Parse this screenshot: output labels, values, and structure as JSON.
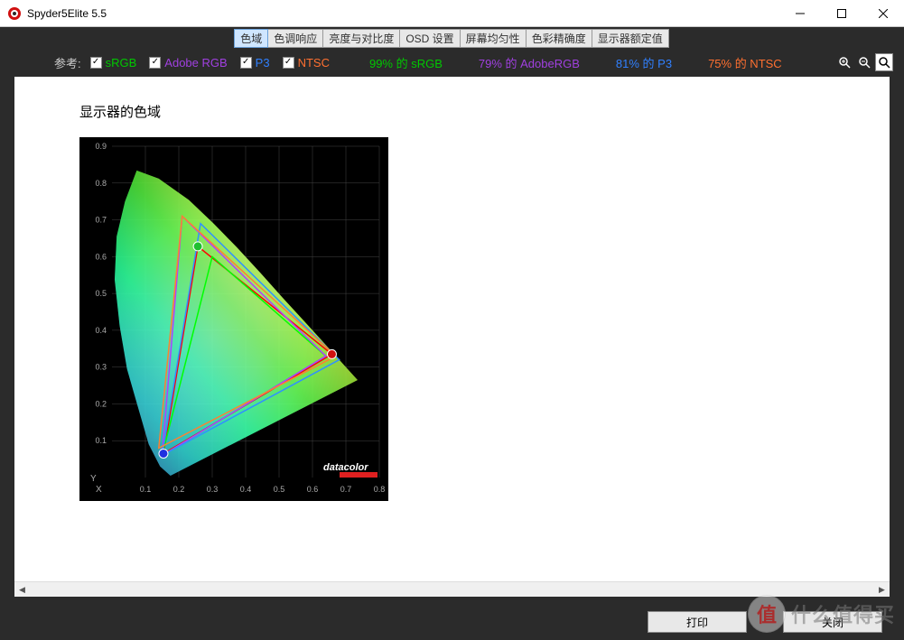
{
  "title": "Spyder5Elite 5.5",
  "tabs": [
    {
      "label": "色域",
      "active": true
    },
    {
      "label": "色调响应",
      "active": false
    },
    {
      "label": "亮度与对比度",
      "active": false
    },
    {
      "label": "OSD 设置",
      "active": false
    },
    {
      "label": "屏幕均匀性",
      "active": false
    },
    {
      "label": "色彩精确度",
      "active": false
    },
    {
      "label": "显示器额定值",
      "active": false
    }
  ],
  "reference_label": "参考:",
  "checkboxes": {
    "srgb": {
      "label": "sRGB",
      "checked": true
    },
    "adobergb": {
      "label": "Adobe RGB",
      "checked": true
    },
    "p3": {
      "label": "P3",
      "checked": true
    },
    "ntsc": {
      "label": "NTSC",
      "checked": true
    }
  },
  "coverage": {
    "srgb": "99% 的 sRGB",
    "adobergb": "79% 的 AdobeRGB",
    "p3": "81% 的 P3",
    "ntsc": "75% 的 NTSC"
  },
  "chart_title": "显示器的色域",
  "chart_brand": "datacolor",
  "buttons": {
    "print": "打印",
    "close": "关闭"
  },
  "watermark": {
    "icon": "值",
    "text": "什么值得买"
  },
  "chart_data": {
    "type": "chromaticity",
    "title": "显示器的色域",
    "xlabel": "X",
    "ylabel": "Y",
    "xlim": [
      0.0,
      0.8
    ],
    "ylim": [
      0.0,
      0.9
    ],
    "xticks": [
      0.1,
      0.2,
      0.3,
      0.4,
      0.5,
      0.6,
      0.7,
      0.8
    ],
    "yticks": [
      0.1,
      0.2,
      0.3,
      0.4,
      0.5,
      0.6,
      0.7,
      0.8,
      0.9
    ],
    "spectral_locus": [
      [
        0.175,
        0.005
      ],
      [
        0.144,
        0.03
      ],
      [
        0.11,
        0.09
      ],
      [
        0.075,
        0.2
      ],
      [
        0.045,
        0.295
      ],
      [
        0.023,
        0.412
      ],
      [
        0.008,
        0.538
      ],
      [
        0.014,
        0.655
      ],
      [
        0.039,
        0.75
      ],
      [
        0.074,
        0.834
      ],
      [
        0.14,
        0.812
      ],
      [
        0.23,
        0.754
      ],
      [
        0.302,
        0.692
      ],
      [
        0.374,
        0.625
      ],
      [
        0.445,
        0.555
      ],
      [
        0.512,
        0.487
      ],
      [
        0.576,
        0.424
      ],
      [
        0.628,
        0.372
      ],
      [
        0.691,
        0.309
      ],
      [
        0.735,
        0.265
      ]
    ],
    "series": [
      {
        "name": "Monitor",
        "color": "#ff0000",
        "points": [
          [
            0.658,
            0.335
          ],
          [
            0.257,
            0.628
          ],
          [
            0.154,
            0.065
          ]
        ]
      },
      {
        "name": "sRGB",
        "color": "#00ff00",
        "points": [
          [
            0.64,
            0.33
          ],
          [
            0.3,
            0.6
          ],
          [
            0.15,
            0.06
          ]
        ]
      },
      {
        "name": "Adobe RGB",
        "color": "#b040ff",
        "points": [
          [
            0.64,
            0.33
          ],
          [
            0.21,
            0.71
          ],
          [
            0.15,
            0.06
          ]
        ]
      },
      {
        "name": "P3",
        "color": "#3090ff",
        "points": [
          [
            0.68,
            0.32
          ],
          [
            0.265,
            0.69
          ],
          [
            0.15,
            0.06
          ]
        ]
      },
      {
        "name": "NTSC",
        "color": "#ff8030",
        "points": [
          [
            0.67,
            0.33
          ],
          [
            0.21,
            0.71
          ],
          [
            0.14,
            0.08
          ]
        ]
      }
    ],
    "markers": [
      {
        "name": "Red primary",
        "xy": [
          0.658,
          0.335
        ],
        "color": "#d01010"
      },
      {
        "name": "Green primary",
        "xy": [
          0.257,
          0.628
        ],
        "color": "#20c030"
      },
      {
        "name": "Blue primary",
        "xy": [
          0.154,
          0.065
        ],
        "color": "#2030e0"
      }
    ]
  }
}
